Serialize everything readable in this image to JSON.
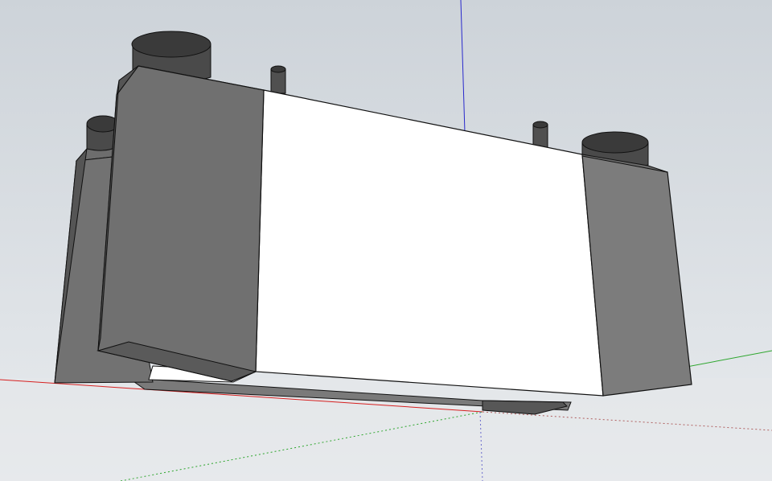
{
  "colors": {
    "sky_top": "#cdd3d9",
    "sky_bottom": "#e8ebee",
    "red_axis": "#d62020",
    "green_axis": "#2ea62e",
    "blue_axis": "#2828cc",
    "dark_face": "#575757",
    "mid_face": "#707070",
    "light_face": "#7c7c7c",
    "white_face": "#ffffff",
    "cylinder_top": "#3a3a3a",
    "cylinder_side": "#4a4a4a",
    "edge": "#111111"
  },
  "scene": {
    "model": "3d-box-assembly",
    "components": [
      "left-end-block",
      "center-white-panel",
      "right-end-block",
      "top-cylinders",
      "top-pins",
      "base-plate"
    ]
  }
}
